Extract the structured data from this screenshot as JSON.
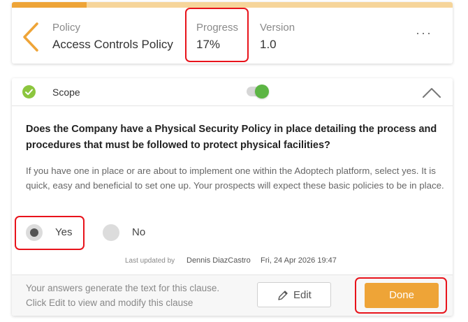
{
  "header": {
    "progress_fraction": 0.17,
    "policy_label": "Policy",
    "policy_value": "Access Controls Policy",
    "progress_label": "Progress",
    "progress_value": "17%",
    "version_label": "Version",
    "version_value": "1.0",
    "more_label": "···",
    "back_icon": "chevron-left-icon"
  },
  "section": {
    "title": "Scope",
    "status_icon": "check-circle-icon",
    "toggle_on": true,
    "collapse_icon": "chevron-up-icon"
  },
  "question": {
    "text": "Does the Company have a Physical Security Policy in place detailing the process and procedures that must be followed to protect physical facilities?",
    "helper": "If you have one in place or are about to implement one within the Adoptech platform, select yes. It is quick, easy and beneficial to set one up. Your prospects will expect these basic policies to be in place.",
    "options": [
      {
        "label": "Yes",
        "selected": true
      },
      {
        "label": "No",
        "selected": false
      }
    ]
  },
  "meta": {
    "updated_label": "Last updated by",
    "updated_by": "Dennis DiazCastro",
    "updated_at": "Fri, 24 Apr 2026 19:47"
  },
  "footer": {
    "line1": "Your answers generate the text for this clause.",
    "line2": "Click Edit to view and modify this clause",
    "edit_label": "Edit",
    "done_label": "Done"
  },
  "colors": {
    "accent": "#eea437",
    "accent_light": "#f6d59a",
    "success": "#8cc63e",
    "highlight": "#e8131b"
  }
}
